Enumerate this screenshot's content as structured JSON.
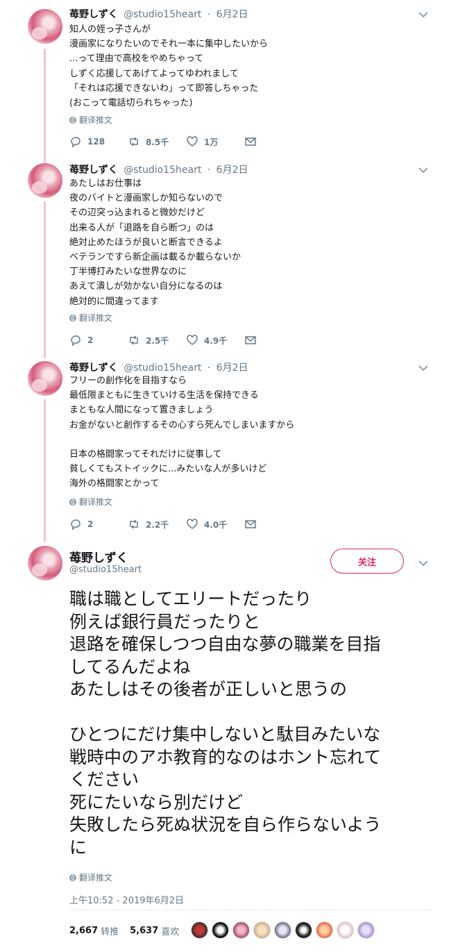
{
  "tweets": [
    {
      "name": "苺野しずく",
      "handle": "@studio15heart",
      "date": "6月2日",
      "text": "知人の姪っ子さんが\n漫画家になりたいのでそれ一本に集中したいから\n...って理由で高校をやめちゃって\nしずく応援してあげてよってゆわれまして\n「それは応援できないわ」って即答しちゃった\n(おこって電話切られちゃった)",
      "translate": "翻译推文",
      "replies": "128",
      "retweets": "8.5千",
      "likes": "1万"
    },
    {
      "name": "苺野しずく",
      "handle": "@studio15heart",
      "date": "6月2日",
      "text": "あたしはお仕事は\n夜のバイトと漫画家しか知らないので\nその辺突っ込まれると微妙だけど\n出来る人が「退路を自ら断つ」のは\n絶対止めたほうが良いと断言できるよ\nベテランですら新企画は載るか載らないか\n丁半博打みたいな世界なのに\nあえて潰しが効かない自分になるのは\n絶対的に間違ってます",
      "translate": "翻译推文",
      "replies": "2",
      "retweets": "2.5千",
      "likes": "4.9千"
    },
    {
      "name": "苺野しずく",
      "handle": "@studio15heart",
      "date": "6月2日",
      "text": "フリーの創作化を目指すなら\n最低限まともに生きていける生活を保持できる\nまともな人間になって置きましょう\nお金がないと創作するその心すら死んでしまいますから\n\n日本の格闘家ってそれだけに従事して\n貧しくてもストイックに...みたいな人が多いけど\n海外の格闘家とかって",
      "translate": "翻译推文",
      "replies": "2",
      "retweets": "2.2千",
      "likes": "4.0千"
    }
  ],
  "main": {
    "name": "苺野しずく",
    "handle": "@studio15heart",
    "follow_label": "关注",
    "text": "職は職としてエリートだったり\n例えば銀行員だったりと\n退路を確保しつつ自由な夢の職業を目指\nしてるんだよね\nあたしはその後者が正しいと思うの\n\nひとつにだけ集中しないと駄目みたいな\n戦時中のアホ教育的なのはホント忘れて\nください\n死にたいなら別だけど\n失敗したら死ぬ状況を自ら作らないよう\nに",
    "translate": "翻译推文",
    "timestamp": "上午10:52 - 2019年6月2日",
    "retweet_count": "2,667",
    "retweet_label": "转推",
    "like_count": "5,637",
    "like_label": "喜欢"
  },
  "colors": {
    "accent": "#e0245e",
    "thread_line": "#f1c5d2",
    "muted": "#657786"
  }
}
